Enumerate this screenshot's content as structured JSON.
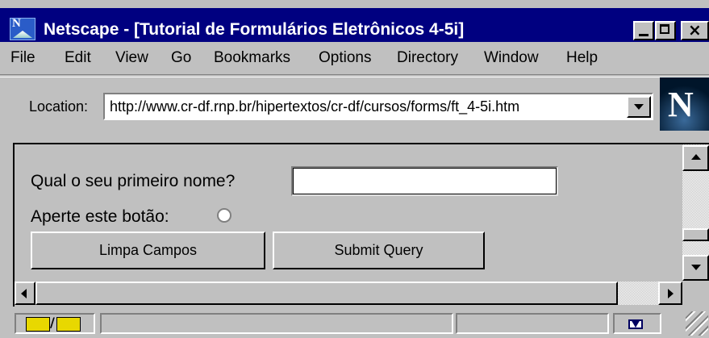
{
  "window": {
    "title": "Netscape - [Tutorial de Formulários Eletrônicos 4-5i]"
  },
  "menu": [
    "File",
    "Edit",
    "View",
    "Go",
    "Bookmarks",
    "Options",
    "Directory",
    "Window",
    "Help"
  ],
  "location": {
    "label": "Location:",
    "url": "http://www.cr-df.rnp.br/hipertextos/cr-df/cursos/forms/ft_4-5i.htm"
  },
  "form": {
    "name_question": "Qual o seu primeiro nome?",
    "name_value": "",
    "button_prompt": "Aperte este botão:",
    "reset_label": "Limpa Campos",
    "submit_label": "Submit Query"
  },
  "icons": {
    "app": "netscape-app-icon",
    "logo": "netscape-n-logo",
    "security": "security-key-icon",
    "mail": "mail-envelope-icon"
  },
  "colors": {
    "titlebar": "#000080",
    "face": "#c0c0c0"
  }
}
